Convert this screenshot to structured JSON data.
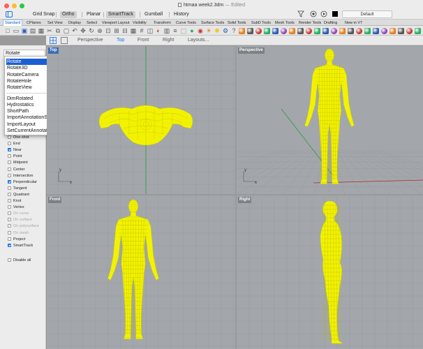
{
  "window": {
    "title": "htmaa week2.3dm",
    "status": "— Edited"
  },
  "toolbar": {
    "grid_snap": "Grid Snap",
    "ortho": "Ortho",
    "planar": "Planar",
    "smarttrack": "SmartTrack",
    "gumball": "Gumball",
    "history": "History",
    "layer_default": "Default"
  },
  "tabs": [
    "Standard",
    "CPlanes",
    "Set View",
    "Display",
    "Select",
    "Viewport Layout",
    "Visibility",
    "Transform",
    "Curve Tools",
    "Surface Tools",
    "Solid Tools",
    "SubD Tools",
    "Mesh Tools",
    "Render Tools",
    "Drafting",
    "New in V7"
  ],
  "active_tab": "Standard",
  "view_toolbar": {
    "perspective": "Perspective",
    "top": "Top",
    "front": "Front",
    "right": "Right",
    "layouts": "Layouts..."
  },
  "command": {
    "input": "Rotate",
    "suggestions": [
      "Rotate",
      "Rotate3D",
      "RotateCamera",
      "RotateHole",
      "RotateView"
    ],
    "more": [
      "DimRotated",
      "Hydrostatics",
      "ShortPath",
      "ImportAnnotationStyles",
      "ImportLayout",
      "SetCurrentAnnotationStyle"
    ]
  },
  "osnaps": [
    {
      "label": "One shot",
      "checked": false,
      "dim": false
    },
    {
      "label": "End",
      "checked": false,
      "dim": false
    },
    {
      "label": "Near",
      "checked": true,
      "dim": false
    },
    {
      "label": "Point",
      "checked": false,
      "dim": false
    },
    {
      "label": "Midpoint",
      "checked": false,
      "dim": false
    },
    {
      "label": "Center",
      "checked": false,
      "dim": false
    },
    {
      "label": "Intersection",
      "checked": false,
      "dim": false
    },
    {
      "label": "Perpendicular",
      "checked": true,
      "dim": false
    },
    {
      "label": "Tangent",
      "checked": false,
      "dim": false
    },
    {
      "label": "Quadrant",
      "checked": false,
      "dim": false
    },
    {
      "label": "Knot",
      "checked": false,
      "dim": false
    },
    {
      "label": "Vertex",
      "checked": false,
      "dim": false
    },
    {
      "label": "On curve",
      "checked": false,
      "dim": true
    },
    {
      "label": "On surface",
      "checked": false,
      "dim": true
    },
    {
      "label": "On polysurface",
      "checked": false,
      "dim": true
    },
    {
      "label": "On mesh",
      "checked": false,
      "dim": true
    },
    {
      "label": "Project",
      "checked": false,
      "dim": false
    },
    {
      "label": "SmartTrack",
      "checked": true,
      "dim": false
    },
    {
      "label": "Disable all",
      "checked": false,
      "dim": false
    }
  ],
  "viewports": {
    "top": "Top",
    "perspective": "Perspective",
    "front": "Front",
    "right": "Right"
  },
  "axes": {
    "x": "x",
    "y": "y"
  },
  "colors": {
    "mesh": "#f2f200",
    "accent": "#1a73e8",
    "x_axis": "#b0262a",
    "y_axis": "#2b9a3a",
    "viewport_bg": "#a3a7ab"
  },
  "icons": [
    "new-file-icon",
    "open-icon",
    "save-icon",
    "print-icon",
    "import-icon",
    "cut-icon",
    "copy-icon",
    "paste-icon",
    "undo-icon",
    "pan-icon",
    "rotate-view-icon",
    "zoom-icon",
    "zoom-window-icon",
    "zoom-extents-icon",
    "zoom-selected-icon",
    "four-view-icon",
    "grid-icon",
    "cplane-icon",
    "display-mode-icon",
    "properties-icon",
    "layer-icon",
    "select-icon",
    "render-icon",
    "material-icon",
    "light-icon",
    "sun-icon",
    "options-icon",
    "help-icon"
  ]
}
